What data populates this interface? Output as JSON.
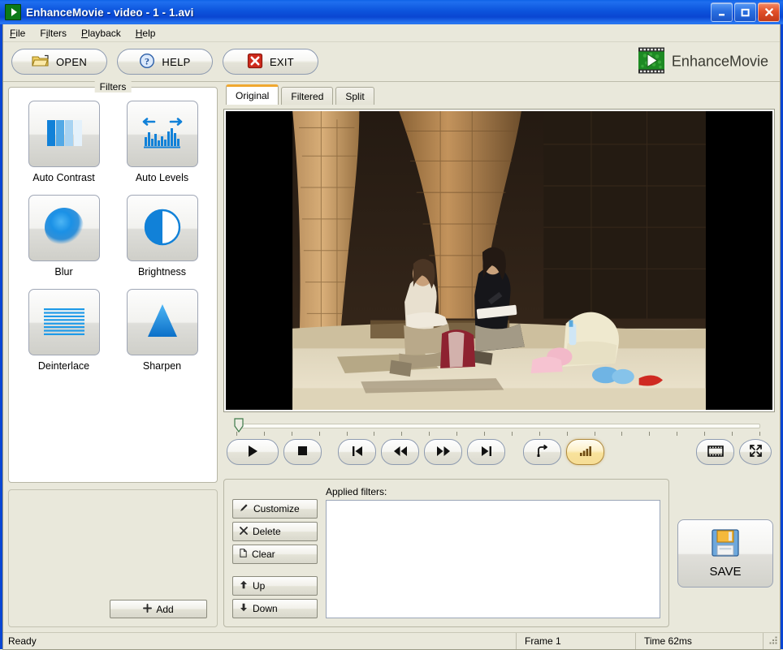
{
  "window": {
    "title": "EnhanceMovie - video - 1 - 1.avi",
    "app_icon": "green-arrow-icon",
    "controls": {
      "minimize": "minimize-button",
      "maximize": "maximize-button",
      "close": "close-button"
    },
    "accent_titlebar": "#0a46d2",
    "background": "#e9e8db"
  },
  "menu": {
    "items": [
      {
        "label": "File",
        "mnemonic": "F"
      },
      {
        "label": "Filters",
        "mnemonic": "i"
      },
      {
        "label": "Playback",
        "mnemonic": "P"
      },
      {
        "label": "Help",
        "mnemonic": "H"
      }
    ]
  },
  "toolbar": {
    "open_label": "OPEN",
    "help_label": "HELP",
    "exit_label": "EXIT",
    "logo_text": "EnhanceMovie"
  },
  "filters_panel": {
    "title": "Filters",
    "items": [
      {
        "label": "Auto Contrast",
        "icon": "contrast-bars-icon"
      },
      {
        "label": "Auto Levels",
        "icon": "histogram-arrows-icon"
      },
      {
        "label": "Blur",
        "icon": "blurred-circle-icon"
      },
      {
        "label": "Brightness",
        "icon": "half-circle-icon"
      },
      {
        "label": "Deinterlace",
        "icon": "scanlines-icon"
      },
      {
        "label": "Sharpen",
        "icon": "triangle-peak-icon"
      }
    ]
  },
  "presets_panel": {
    "add_label": "Add",
    "add_icon": "plus-icon"
  },
  "preview": {
    "tabs": [
      {
        "label": "Original",
        "active": true
      },
      {
        "label": "Filtered",
        "active": false
      },
      {
        "label": "Split",
        "active": false
      }
    ]
  },
  "transport": {
    "position_percent": 0,
    "buttons": [
      {
        "name": "play-button",
        "icon": "play-icon"
      },
      {
        "name": "stop-button",
        "icon": "stop-icon"
      },
      {
        "name": "first-frame-button",
        "icon": "skip-back-icon"
      },
      {
        "name": "rewind-button",
        "icon": "rewind-icon"
      },
      {
        "name": "forward-button",
        "icon": "fast-forward-icon"
      },
      {
        "name": "last-frame-button",
        "icon": "skip-forward-icon"
      },
      {
        "name": "loop-button",
        "icon": "loop-icon"
      },
      {
        "name": "levels-button",
        "icon": "signal-bars-icon",
        "highlighted": true
      },
      {
        "name": "filmstrip-button",
        "icon": "filmstrip-icon"
      },
      {
        "name": "fullscreen-button",
        "icon": "expand-arrows-icon"
      }
    ],
    "highlight_color": "#f6dd96"
  },
  "applied_filters": {
    "label": "Applied filters:",
    "entries": [],
    "buttons": [
      {
        "label": "Customize",
        "icon": "pencil-icon"
      },
      {
        "label": "Delete",
        "icon": "x-icon"
      },
      {
        "label": "Clear",
        "icon": "page-icon"
      },
      {
        "label": "Up",
        "icon": "arrow-up-icon"
      },
      {
        "label": "Down",
        "icon": "arrow-down-icon"
      }
    ]
  },
  "save": {
    "label": "SAVE",
    "icon": "floppy-disk-icon"
  },
  "statusbar": {
    "status": "Ready",
    "frame": "Frame 1",
    "time": "Time 62ms"
  }
}
